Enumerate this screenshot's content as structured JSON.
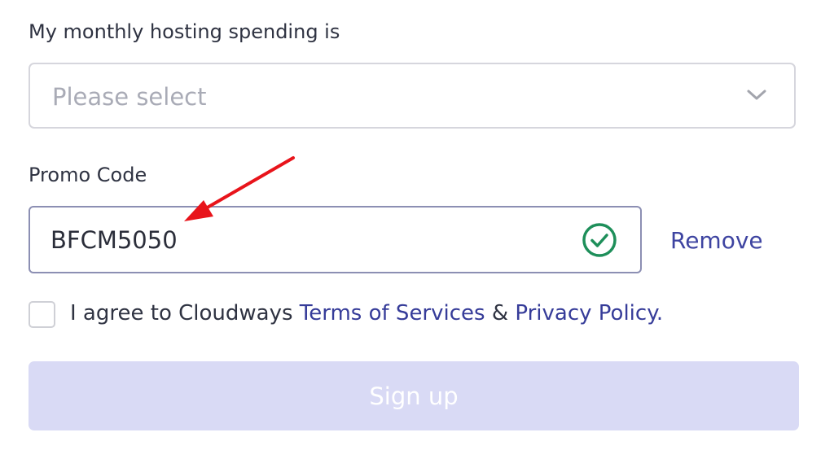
{
  "form": {
    "spend_label": "My monthly hosting spending is",
    "spend_select": {
      "placeholder": "Please select",
      "icon": "chevron-down-icon"
    },
    "promo_label": "Promo Code",
    "promo_value": "BFCM5050",
    "promo_status_icon": "check-circle-icon",
    "remove_label": "Remove",
    "agree": {
      "prefix": "I agree to Cloudways ",
      "terms_link": "Terms of Services",
      "joiner": " & ",
      "privacy_link": "Privacy Policy.",
      "checked": false
    },
    "signup_label": "Sign up"
  },
  "annotation": {
    "icon": "red-arrow-icon",
    "color": "#e8141b"
  },
  "colors": {
    "accent_link": "#363c99",
    "success_green": "#1e8f5a",
    "button_disabled_bg": "#d9daf5"
  }
}
